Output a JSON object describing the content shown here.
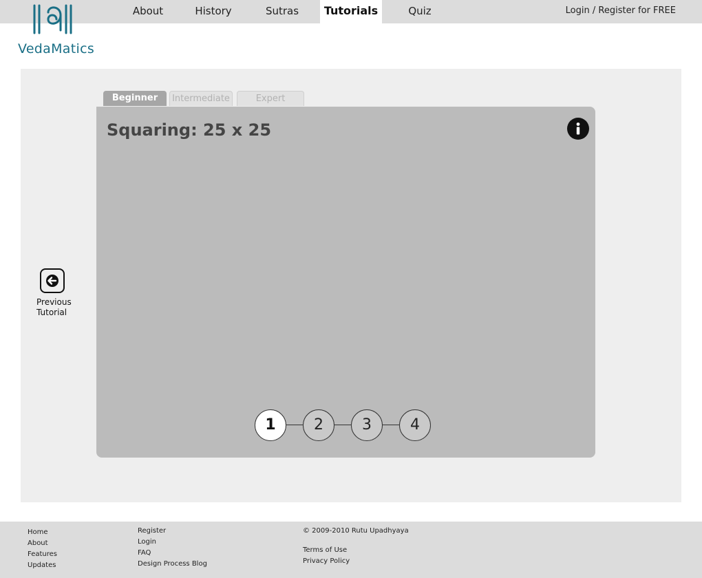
{
  "brand": {
    "name": "VedaMatics",
    "color": "#1a6f86"
  },
  "nav": {
    "items": [
      {
        "label": "About"
      },
      {
        "label": "History"
      },
      {
        "label": "Sutras"
      },
      {
        "label": "Tutorials",
        "active": true
      },
      {
        "label": "Quiz"
      }
    ],
    "login": "Login / Register for FREE"
  },
  "tabs": [
    {
      "label": "Beginner",
      "active": true
    },
    {
      "label": "Intermediate"
    },
    {
      "label": "Expert"
    }
  ],
  "tutorial": {
    "title": "Squaring: 25 x 25",
    "info_icon": "info-icon",
    "steps": [
      "1",
      "2",
      "3",
      "4"
    ],
    "current_step": "1"
  },
  "prev_tutorial": {
    "line1": "Previous",
    "line2": "Tutorial",
    "icon": "arrow-left-icon"
  },
  "footer": {
    "col1": [
      "Home",
      "About",
      "Features",
      "Updates"
    ],
    "col2": [
      "Register",
      "Login",
      "FAQ",
      "Design Process Blog"
    ],
    "copyright": "© 2009-2010 Rutu Upadhyaya",
    "legal": [
      "Terms of Use",
      "Privacy Policy"
    ]
  },
  "colors": {
    "nav_bg": "#dcdcdc",
    "content_bg": "#eeeeee",
    "panel_bg": "#bbbbbb",
    "tab_active": "#a6a6a6"
  }
}
